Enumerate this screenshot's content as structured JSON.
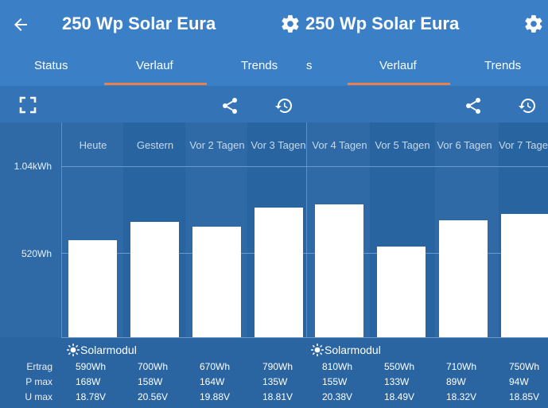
{
  "appbar": {
    "title_left": "250 Wp Solar Eura",
    "title_right": "250 Wp Solar Eura",
    "tabs": [
      {
        "label": "Status"
      },
      {
        "label": "Verlauf"
      },
      {
        "label": "Trends"
      },
      {
        "label": "s"
      },
      {
        "label": "Verlauf"
      },
      {
        "label": "Trends"
      }
    ],
    "back_icon": "arrow-left-icon",
    "settings_icon": "gear-icon"
  },
  "toolbar": {
    "fullscreen_icon": "fullscreen-icon",
    "share_icon": "share-icon",
    "history_icon": "history-icon"
  },
  "colors": {
    "appbar": "#3b7fc6",
    "background": "#2f6aa6",
    "tab_indicator": "#e8804a",
    "bar": "#ffffff"
  },
  "chart_data": {
    "type": "bar",
    "categories": [
      "Heute",
      "Gestern",
      "Vor 2 Tagen",
      "Vor 3 Tagen",
      "Vor 4 Tagen",
      "Vor 5 Tagen",
      "Vor 6 Tagen",
      "Vor 7 Tage"
    ],
    "values": [
      590,
      700,
      670,
      790,
      810,
      550,
      710,
      750
    ],
    "unit": "Wh",
    "yticks": [
      "1.04kWh",
      "520Wh"
    ],
    "ytick_values": [
      1040,
      520
    ],
    "ylim": [
      0,
      1040
    ],
    "grid": true
  },
  "stats": {
    "module_label_left": "Solarmodul",
    "module_label_right": "Solarmodul",
    "row_labels": [
      "Ertrag",
      "P max",
      "U max"
    ],
    "ertrag": [
      "590Wh",
      "700Wh",
      "670Wh",
      "790Wh",
      "810Wh",
      "550Wh",
      "710Wh",
      "750Wh"
    ],
    "pmax": [
      "168W",
      "158W",
      "164W",
      "135W",
      "155W",
      "133W",
      "89W",
      "94W"
    ],
    "umax": [
      "18.78V",
      "20.56V",
      "19.88V",
      "18.81V",
      "20.38V",
      "18.49V",
      "18.32V",
      "18.85V"
    ]
  }
}
